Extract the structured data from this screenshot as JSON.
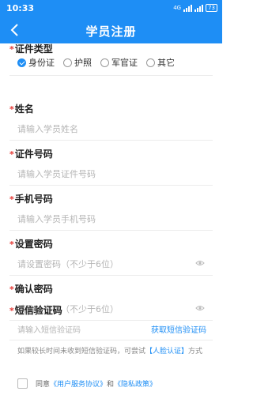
{
  "status_bar": {
    "time": "10:33",
    "network": "4G",
    "battery": "73"
  },
  "header": {
    "title": "学员注册",
    "back_icon": "chevron-left-icon"
  },
  "form": {
    "id_type": {
      "label": "证件类型",
      "options": [
        "身份证",
        "护照",
        "军官证",
        "其它"
      ],
      "selected": "身份证"
    },
    "name": {
      "label": "姓名",
      "placeholder": "请输入学员姓名"
    },
    "id_number": {
      "label": "证件号码",
      "placeholder": "请输入学员证件号码"
    },
    "phone": {
      "label": "手机号码",
      "placeholder": "请输入学员手机号码"
    },
    "password": {
      "label": "设置密码",
      "placeholder": "请设置密码（不少于6位）",
      "icon": "eye-icon"
    },
    "confirm_password": {
      "label": "确认密码",
      "placeholder": "请确认密码（不少于6位）",
      "icon": "eye-icon"
    },
    "sms_code": {
      "label": "短信验证码",
      "placeholder": "请输入短信验证码",
      "button": "获取短信验证码"
    }
  },
  "hint": {
    "text_before": "如果较长时间未收到短信验证码，可尝试",
    "link": "【人脸认证】",
    "text_after": "方式"
  },
  "agreement": {
    "prefix": "同意",
    "terms_link": "《用户服务协议》",
    "and": "和",
    "privacy_link": "《隐私政策》"
  },
  "colors": {
    "primary": "#1e8ef5",
    "required": "#e53935",
    "placeholder": "#b5b5b5"
  }
}
